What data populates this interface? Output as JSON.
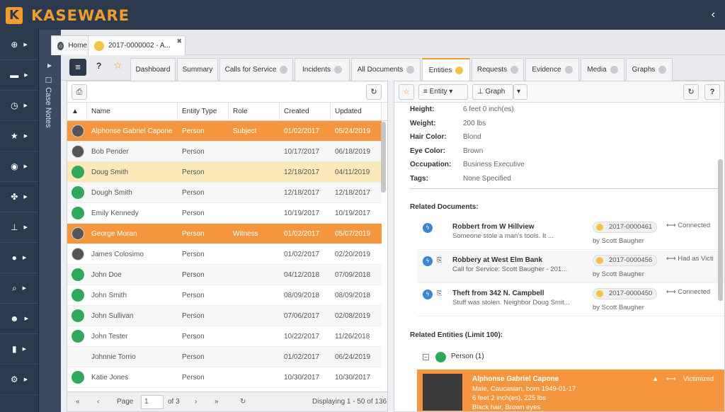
{
  "app": {
    "logo_letter": "K",
    "brand": "KASEWARE",
    "collapse_icon": "‹"
  },
  "nav": [
    "plus-icon",
    "briefcase-icon",
    "clock-icon",
    "star-icon",
    "podcast-icon",
    "biohazard-icon",
    "sitemap-icon",
    "globe-icon",
    "search-icon",
    "users-icon",
    "file-icon",
    "cogs-icon"
  ],
  "casenotes": {
    "label": "Case Notes"
  },
  "tabs": {
    "home": "Home",
    "case": "2017-0000002 - A..."
  },
  "subtabs": [
    "Dashboard",
    "Summary",
    "Calls for Service",
    "Incidents",
    "All Documents",
    "Entities",
    "Requests",
    "Evidence",
    "Media",
    "Graphs"
  ],
  "table": {
    "headers": [
      "Name",
      "Entity Type",
      "Role",
      "Created",
      "Updated"
    ],
    "rows": [
      {
        "name": "Alphonse Gabriel Capone",
        "type": "Person",
        "role": "Subject",
        "created": "01/02/2017",
        "updated": "05/24/2019",
        "style": "sel",
        "av": "photo"
      },
      {
        "name": "Bob Pender",
        "type": "Person",
        "role": "",
        "created": "10/17/2017",
        "updated": "06/18/2019",
        "style": "alt",
        "av": "photo"
      },
      {
        "name": "Doug Smith",
        "type": "Person",
        "role": "",
        "created": "12/18/2017",
        "updated": "04/11/2019",
        "style": "hl",
        "av": "green"
      },
      {
        "name": "Dough Smith",
        "type": "Person",
        "role": "",
        "created": "12/18/2017",
        "updated": "12/18/2017",
        "style": "alt",
        "av": "green"
      },
      {
        "name": "Emily Kennedy",
        "type": "Person",
        "role": "",
        "created": "10/19/2017",
        "updated": "10/19/2017",
        "style": "",
        "av": "green"
      },
      {
        "name": "George Moran",
        "type": "Person",
        "role": "Witness",
        "created": "01/02/2017",
        "updated": "05/07/2019",
        "style": "sel",
        "av": "photo"
      },
      {
        "name": "James Colosimo",
        "type": "Person",
        "role": "",
        "created": "01/02/2017",
        "updated": "02/20/2019",
        "style": "",
        "av": "photo"
      },
      {
        "name": "John Doe",
        "type": "Person",
        "role": "",
        "created": "04/12/2018",
        "updated": "07/09/2018",
        "style": "alt",
        "av": "green"
      },
      {
        "name": "John Smith",
        "type": "Person",
        "role": "",
        "created": "08/09/2018",
        "updated": "08/09/2018",
        "style": "",
        "av": "green"
      },
      {
        "name": "John Sullivan",
        "type": "Person",
        "role": "",
        "created": "07/06/2017",
        "updated": "02/08/2019",
        "style": "alt",
        "av": "green"
      },
      {
        "name": "John Tester",
        "type": "Person",
        "role": "",
        "created": "10/22/2017",
        "updated": "11/26/2018",
        "style": "",
        "av": "green"
      },
      {
        "name": "Johnnie Torrio",
        "type": "Person",
        "role": "",
        "created": "01/02/2017",
        "updated": "06/24/2019",
        "style": "alt",
        "av": "none"
      },
      {
        "name": "Katie Jones",
        "type": "Person",
        "role": "",
        "created": "10/30/2017",
        "updated": "10/30/2017",
        "style": "",
        "av": "green"
      }
    ]
  },
  "pager": {
    "page_label": "Page",
    "page": "1",
    "of": "of 3",
    "display": "Displaying 1 - 50 of 136"
  },
  "right": {
    "entity_dd": "Entity",
    "graph_dd": "Graph",
    "attrs": [
      {
        "k": "Height:",
        "v": "6 feet 0 inch(es)"
      },
      {
        "k": "Weight:",
        "v": "200 lbs"
      },
      {
        "k": "Hair Color:",
        "v": "Blond"
      },
      {
        "k": "Eye Color:",
        "v": "Brown"
      },
      {
        "k": "Occupation:",
        "v": "Business Executive"
      },
      {
        "k": "Tags:",
        "v": "None Specified"
      }
    ],
    "related_docs_title": "Related Documents:",
    "docs": [
      {
        "title": "Robbert from W Hillview",
        "desc": "Someone stole a man's tools.  It ...",
        "num": "2017-0000461",
        "by": "by Scott Baugher",
        "conn": "Connected"
      },
      {
        "title": "Robbery at West Elm Bank",
        "desc": "Call for Service: Scott Baugher - 201...",
        "num": "2017-0000456",
        "by": "by Scott Baugher",
        "conn": "Had as Victi"
      },
      {
        "title": "Theft from 342 N. Campbell",
        "desc": "Stuff was stolen.  Neighbor Doug Smit...",
        "num": "2017-0000450",
        "by": "by Scott Baugher",
        "conn": "Connected"
      }
    ],
    "related_entities_title": "Related Entities (Limit 100):",
    "group_label": "Person (1)",
    "entity": {
      "name": "Alphonse Gabriel Capone",
      "l1": "Male, Caucasian, born 1949-01-17",
      "l2": "6 feet 2 inch(es), 225 lbs",
      "l3": "Black hair, Brown eyes",
      "conn": "Victimized"
    }
  }
}
